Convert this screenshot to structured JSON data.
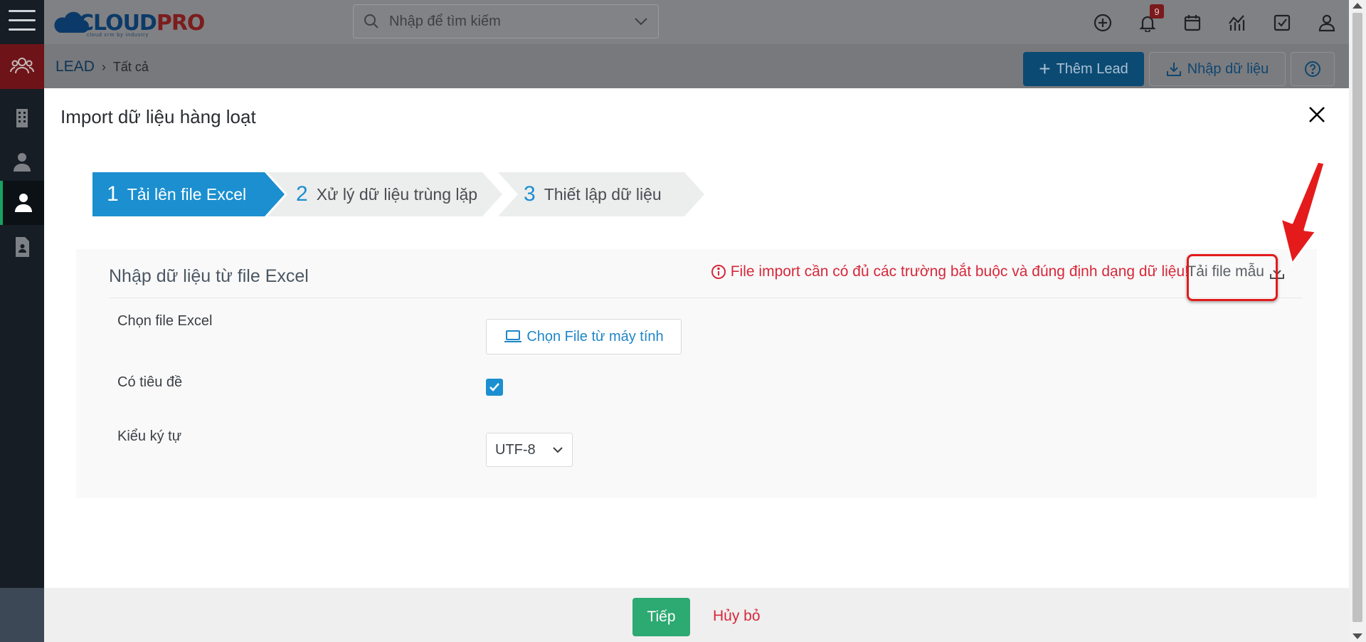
{
  "app": {
    "logo_text": "CLOUD",
    "logo_text_accent": "PRO",
    "logo_tagline": "cloud crm by industry"
  },
  "search": {
    "placeholder": "Nhập để tìm kiếm"
  },
  "header": {
    "notification_count": "9"
  },
  "breadcrumb": {
    "module": "LEAD",
    "current": "Tất cả"
  },
  "actions": {
    "add_label": "Thêm Lead",
    "import_label": "Nhập dữ liệu"
  },
  "modal": {
    "title": "Import dữ liệu hàng loạt",
    "steps": [
      {
        "num": "1",
        "label": "Tải lên file Excel",
        "active": true
      },
      {
        "num": "2",
        "label": "Xử lý dữ liệu trùng lặp",
        "active": false
      },
      {
        "num": "3",
        "label": "Thiết lập dữ liệu",
        "active": false
      }
    ],
    "panel_title": "Nhập dữ liệu từ file Excel",
    "warning": "File import cần có đủ các trường bắt buộc và đúng định dạng dữ liệu!",
    "sample_link": "Tải file mẫu",
    "fields": {
      "file_label": "Chọn file Excel",
      "file_button": "Chọn File từ máy tính",
      "header_label": "Có tiêu đề",
      "header_checked": true,
      "encoding_label": "Kiểu ký tự",
      "encoding_value": "UTF-8"
    },
    "next_label": "Tiếp",
    "cancel_label": "Hủy bỏ"
  },
  "colors": {
    "primary": "#1b8fd0",
    "success": "#2da972",
    "danger": "#d7283a",
    "highlight": "#e21b1b"
  }
}
